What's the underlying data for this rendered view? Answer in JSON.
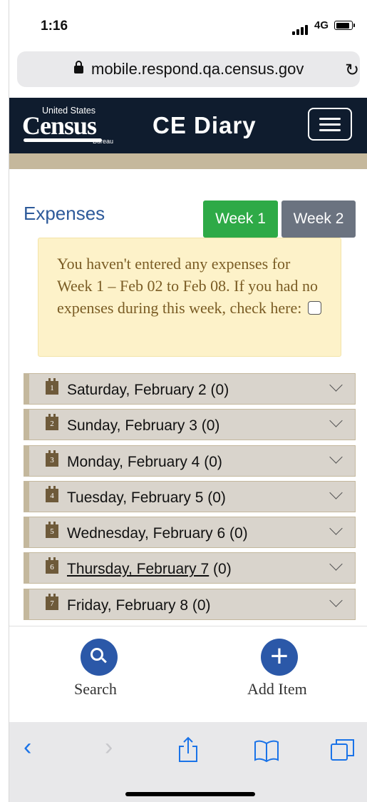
{
  "status_bar": {
    "time": "1:16",
    "network": "4G"
  },
  "browser": {
    "url": "mobile.respond.qa.census.gov"
  },
  "header": {
    "logo_top": "United States",
    "logo_main": "Census",
    "logo_bottom": "Bureau",
    "title": "CE Diary"
  },
  "expenses": {
    "title": "Expenses",
    "week1_label": "Week 1",
    "week2_label": "Week 2",
    "alert_text": "You haven't entered any expenses for Week 1 – Feb 02 to Feb 08. If you had no expenses during this week, check here:",
    "no_expenses_checked": false
  },
  "days": [
    {
      "num": "1",
      "label": "Saturday, February 2",
      "count": " (0)"
    },
    {
      "num": "2",
      "label": "Sunday, February 3",
      "count": " (0)"
    },
    {
      "num": "3",
      "label": "Monday, February 4",
      "count": " (0)"
    },
    {
      "num": "4",
      "label": "Tuesday, February 5",
      "count": " (0)"
    },
    {
      "num": "5",
      "label": "Wednesday, February 6",
      "count": " (0)"
    },
    {
      "num": "6",
      "label": "Thursday, February 7",
      "count": " (0)"
    },
    {
      "num": "7",
      "label": "Friday, February 8",
      "count": " (0)"
    }
  ],
  "toolbar": {
    "search_label": "Search",
    "add_label": "Add Item"
  },
  "colors": {
    "header_bg": "#0f1c2e",
    "accent_blue": "#2b58a8",
    "week_active": "#2eaa47",
    "week_inactive": "#6b7380",
    "alert_bg": "#fdf2c9"
  }
}
